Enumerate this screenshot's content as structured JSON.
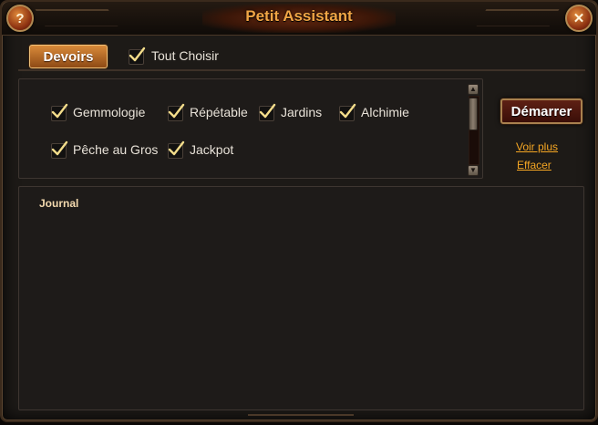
{
  "window": {
    "title": "Petit Assistant",
    "help_label": "?",
    "close_label": "✕"
  },
  "tabs": [
    {
      "label": "Devoirs",
      "active": true
    }
  ],
  "select_all": {
    "label": "Tout Choisir",
    "checked": true
  },
  "tasks": [
    {
      "label": "Gemmologie",
      "checked": true
    },
    {
      "label": "Répétable",
      "checked": true
    },
    {
      "label": "Jardins",
      "checked": true
    },
    {
      "label": "Alchimie",
      "checked": true
    },
    {
      "label": "Pêche au Gros",
      "checked": true
    },
    {
      "label": "Jackpot",
      "checked": true
    }
  ],
  "actions": {
    "start_label": "Démarrer",
    "more_label": "Voir plus",
    "clear_label": "Effacer"
  },
  "journal": {
    "title": "Journal"
  },
  "icons": {
    "check": "check-icon",
    "scroll_up": "arrow-up-icon",
    "scroll_down": "arrow-down-icon"
  },
  "colors": {
    "title": "#f0a545",
    "link": "#f5a623",
    "tab": "#c9762e",
    "check": "#f2dc8a"
  }
}
